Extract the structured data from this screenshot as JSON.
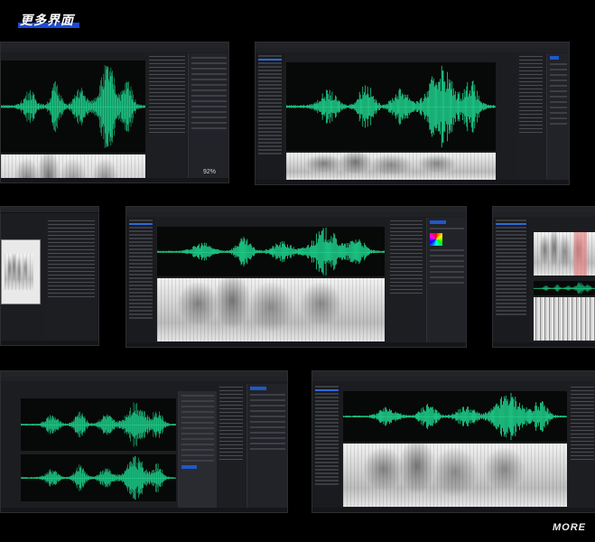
{
  "header": {
    "title": "更多界面"
  },
  "footer": {
    "more_label": "MORE"
  },
  "screens": [
    {
      "name": "screen-top-left",
      "percent": "92%"
    },
    {
      "name": "screen-top-right"
    },
    {
      "name": "screen-mid-left"
    },
    {
      "name": "screen-mid-center"
    },
    {
      "name": "screen-mid-right"
    },
    {
      "name": "screen-bottom-left"
    },
    {
      "name": "screen-bottom-right"
    }
  ],
  "colors": {
    "waveform": "#1fd18c",
    "accent": "#1d4bd6",
    "background": "#000000"
  }
}
